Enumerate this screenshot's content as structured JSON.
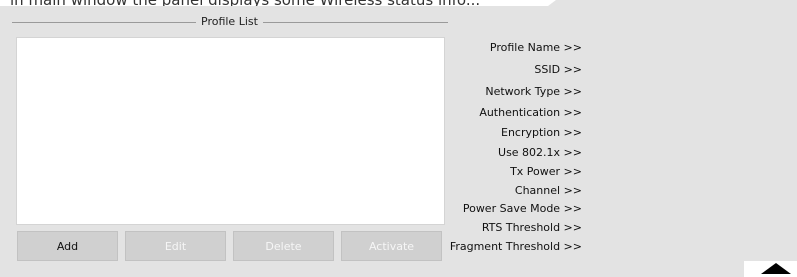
{
  "window": {
    "top_text": "in main window the panel displays some Wireless status info..."
  },
  "profile_list": {
    "title": "Profile List",
    "items": []
  },
  "buttons": {
    "add": "Add",
    "edit": "Edit",
    "delete": "Delete",
    "activate": "Activate"
  },
  "details": [
    {
      "label": "Profile Name >>",
      "value": ""
    },
    {
      "label": "SSID >>",
      "value": ""
    },
    {
      "label": "Network Type >>",
      "value": ""
    },
    {
      "label": "Authentication >>",
      "value": ""
    },
    {
      "label": "Encryption >>",
      "value": ""
    },
    {
      "label": "Use 802.1x >>",
      "value": ""
    },
    {
      "label": "Tx Power >>",
      "value": ""
    },
    {
      "label": "Channel >>",
      "value": ""
    },
    {
      "label": "Power Save Mode >>",
      "value": ""
    },
    {
      "label": "RTS Threshold >>",
      "value": ""
    },
    {
      "label": "Fragment Threshold >>",
      "value": ""
    }
  ],
  "icons": {
    "corner": "triangle-up-icon"
  },
  "colors": {
    "panel_bg": "#e3e3e3",
    "button_bg": "#d0d0d0",
    "disabled_text": "#f6f6f6"
  }
}
